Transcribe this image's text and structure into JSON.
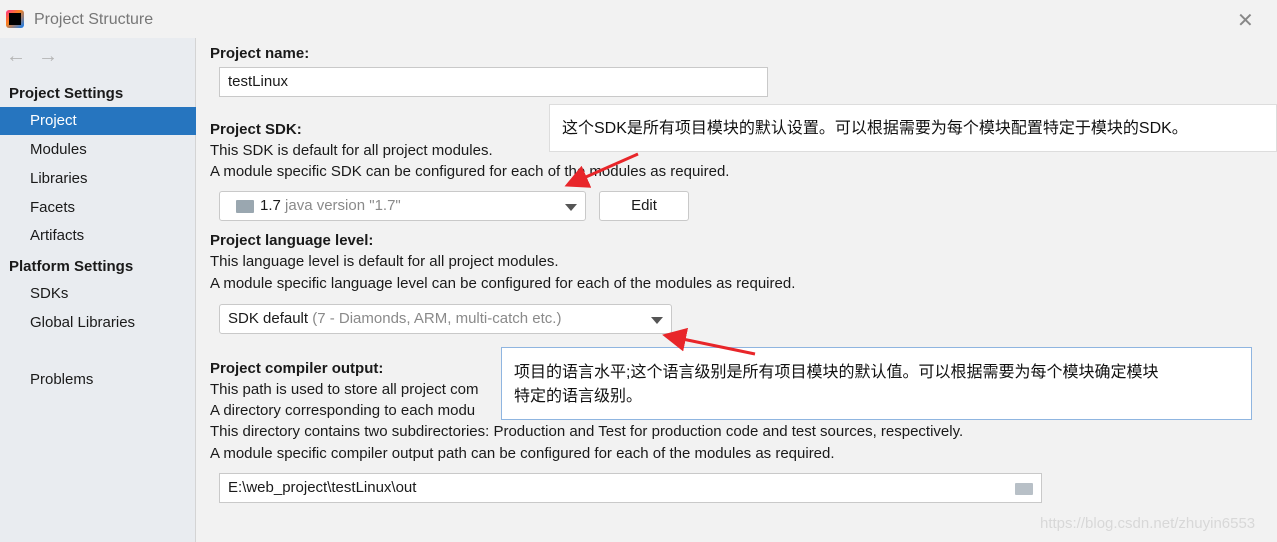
{
  "window": {
    "title": "Project Structure",
    "close_icon": "close-icon"
  },
  "sidebar": {
    "sections": [
      {
        "label": "Project Settings"
      },
      {
        "label": "Platform Settings"
      }
    ],
    "items": [
      {
        "label": "Project",
        "selected": true
      },
      {
        "label": "Modules"
      },
      {
        "label": "Libraries"
      },
      {
        "label": "Facets"
      },
      {
        "label": "Artifacts"
      },
      {
        "label": "SDKs"
      },
      {
        "label": "Global Libraries"
      },
      {
        "label": "Problems"
      }
    ]
  },
  "project": {
    "name_label": "Project name:",
    "name_value": "testLinux",
    "sdk_label": "Project SDK:",
    "sdk_desc1": "This SDK is default for all project modules.",
    "sdk_desc2": "A module specific SDK can be configured for each of the modules as required.",
    "sdk_value": "1.7",
    "sdk_detail": "java version \"1.7\"",
    "edit_button": "Edit",
    "lang_label": "Project language level:",
    "lang_desc1": "This language level is default for all project modules.",
    "lang_desc2": "A module specific language level can be configured for each of the modules as required.",
    "lang_value": "SDK default",
    "lang_detail": "(7 - Diamonds, ARM, multi-catch etc.)",
    "out_label": "Project compiler output:",
    "out_desc1": "This path is used to store all project com",
    "out_desc2": "A directory corresponding to each modu",
    "out_desc3": "This directory contains two subdirectories: Production and Test for production code and test sources, respectively.",
    "out_desc4": "A module specific compiler output path can be configured for each of the modules as required.",
    "out_value": "E:\\web_project\\testLinux\\out"
  },
  "annotations": {
    "callout1": "这个SDK是所有项目模块的默认设置。可以根据需要为每个模块配置特定于模块的SDK。",
    "callout2_line1": "项目的语言水平;这个语言级别是所有项目模块的默认值。可以根据需要为每个模块确定模块",
    "callout2_line2": "特定的语言级别。",
    "arrow_color": "#e8262a"
  },
  "watermark": "https://blog.csdn.net/zhuyin6553"
}
